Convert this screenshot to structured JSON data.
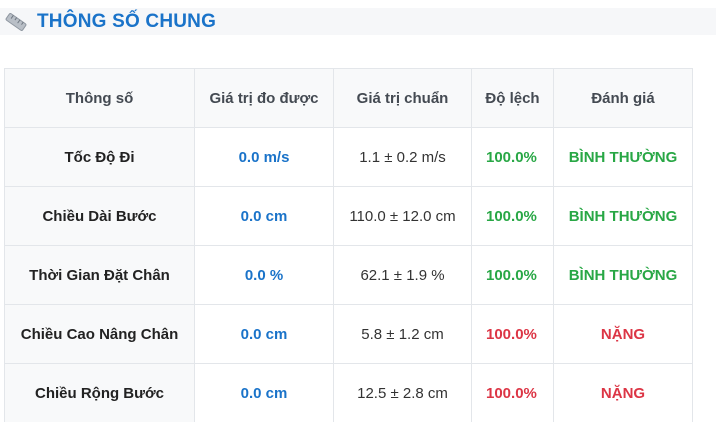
{
  "section": {
    "title": "THÔNG SỐ CHUNG",
    "icon": "ruler-icon"
  },
  "colors": {
    "accent": "#1a73c9",
    "normal": "#28a745",
    "severe": "#dc3545"
  },
  "table": {
    "headers": [
      "Thông số",
      "Giá trị đo được",
      "Giá trị chuẩn",
      "Độ lệch",
      "Đánh giá"
    ],
    "rows": [
      {
        "name": "Tốc Độ Đi",
        "measured": "0.0 m/s",
        "standard": "1.1 ± 0.2 m/s",
        "deviation": "100.0%",
        "rating": "BÌNH THƯỜNG",
        "status": "normal"
      },
      {
        "name": "Chiều Dài Bước",
        "measured": "0.0 cm",
        "standard": "110.0 ± 12.0 cm",
        "deviation": "100.0%",
        "rating": "BÌNH THƯỜNG",
        "status": "normal"
      },
      {
        "name": "Thời Gian Đặt Chân",
        "measured": "0.0 %",
        "standard": "62.1 ± 1.9 %",
        "deviation": "100.0%",
        "rating": "BÌNH THƯỜNG",
        "status": "normal"
      },
      {
        "name": "Chiều Cao Nâng Chân",
        "measured": "0.0 cm",
        "standard": "5.8 ± 1.2 cm",
        "deviation": "100.0%",
        "rating": "NẶNG",
        "status": "severe"
      },
      {
        "name": "Chiều Rộng Bước",
        "measured": "0.0 cm",
        "standard": "12.5 ± 2.8 cm",
        "deviation": "100.0%",
        "rating": "NẶNG",
        "status": "severe"
      }
    ]
  }
}
